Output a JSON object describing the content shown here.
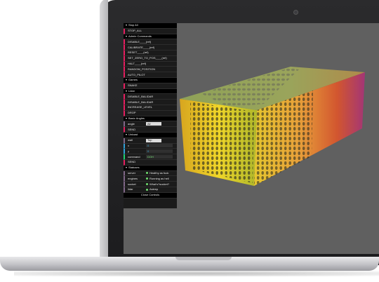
{
  "gui": {
    "stop_folder": "Stop All",
    "stop_all": "STOP_ALL",
    "admin_folder": "Admin Commands",
    "disable": "DISABLE____(ref)",
    "calibrate": "CALIBRATE____(ref)",
    "reset": "RESET____(ref)",
    "set_zero": "SET_ZERO_TO_POS____(ref)",
    "halt": "HALT____(ref)",
    "random": "RANDOM_POSITION",
    "auto_pilot": "AUTO_PILOT",
    "games_folder": "Games",
    "snake": "SNAKE",
    "lidar_folder": "Lidar",
    "disable_lidar": "DISABLE_BALIDAR",
    "enable_lidar": "DISABLE_BALIDAR",
    "increase_level": "INCREASE_LEVEL",
    "drop": "DROP",
    "basic_folder": "Basic Angles",
    "angle_label": "angle",
    "angle_value": "All",
    "send_label": "SEND",
    "unicast_folder": "Unicast",
    "wall_label": "wall",
    "wall_value": "Top",
    "x_label": "x",
    "x_value": "0",
    "y_label": "y",
    "y_value": "0",
    "command_label": "command",
    "command_value": "DOH",
    "send2_label": "SEND",
    "status_folder": "Statuses",
    "server_label": "server",
    "server_value": "Healthy as fuck",
    "engines_label": "engines",
    "engines_value": "Running as hell",
    "socket_label": "socket",
    "socket_value": "What's?socket?",
    "lidar_label": "lidar",
    "lidar_value": "Asleep",
    "close": "Close Controls"
  }
}
